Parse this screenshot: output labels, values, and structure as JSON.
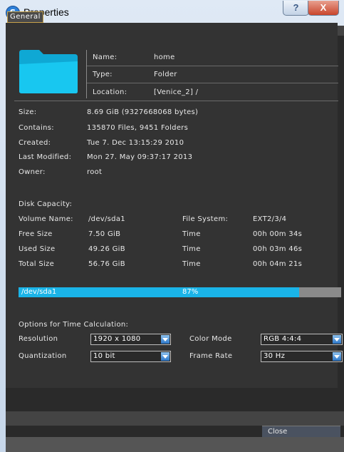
{
  "window": {
    "title": "Properties",
    "help_glyph": "?",
    "close_glyph": "X"
  },
  "tab": {
    "label": "General"
  },
  "header": {
    "name_label": "Name:",
    "name_value": "home",
    "type_label": "Type:",
    "type_value": "Folder",
    "location_label": "Location:",
    "location_value": "[Venice_2] /"
  },
  "info": {
    "size_label": "Size:",
    "size_value": "8.69 GiB (9327668068 bytes)",
    "contains_label": "Contains:",
    "contains_value": "135870 Files, 9451 Folders",
    "created_label": "Created:",
    "created_value": "Tue 7. Dec 13:15:29 2010",
    "modified_label": "Last Modified:",
    "modified_value": "Mon 27. May 09:37:17 2013",
    "owner_label": "Owner:",
    "owner_value": "root"
  },
  "disk": {
    "heading": "Disk Capacity:",
    "volume_label": "Volume Name:",
    "volume_value": "/dev/sda1",
    "fs_label": "File System:",
    "fs_value": "EXT2/3/4",
    "rows": [
      {
        "label": "Free Size",
        "value": "7.50 GiB",
        "time_label": "Time",
        "time_value": "00h 00m 34s"
      },
      {
        "label": "Used Size",
        "value": "49.26 GiB",
        "time_label": "Time",
        "time_value": "00h 03m 46s"
      },
      {
        "label": "Total Size",
        "value": "56.76 GiB",
        "time_label": "Time",
        "time_value": "00h 04m 21s"
      }
    ],
    "bar_label": "/dev/sda1",
    "bar_percent_text": "87%",
    "bar_fraction": 0.87
  },
  "options": {
    "heading": "Options for Time Calculation:",
    "resolution_label": "Resolution",
    "resolution_value": "1920 x 1080",
    "colormode_label": "Color Mode",
    "colormode_value": "RGB 4:4:4",
    "quantization_label": "Quantization",
    "quantization_value": "10 bit",
    "framerate_label": "Frame Rate",
    "framerate_value": "30 Hz"
  },
  "footer": {
    "close_label": "Close"
  },
  "colors": {
    "accent": "#1ab4e8",
    "panel": "#333333",
    "folder": "#18c7f0"
  }
}
